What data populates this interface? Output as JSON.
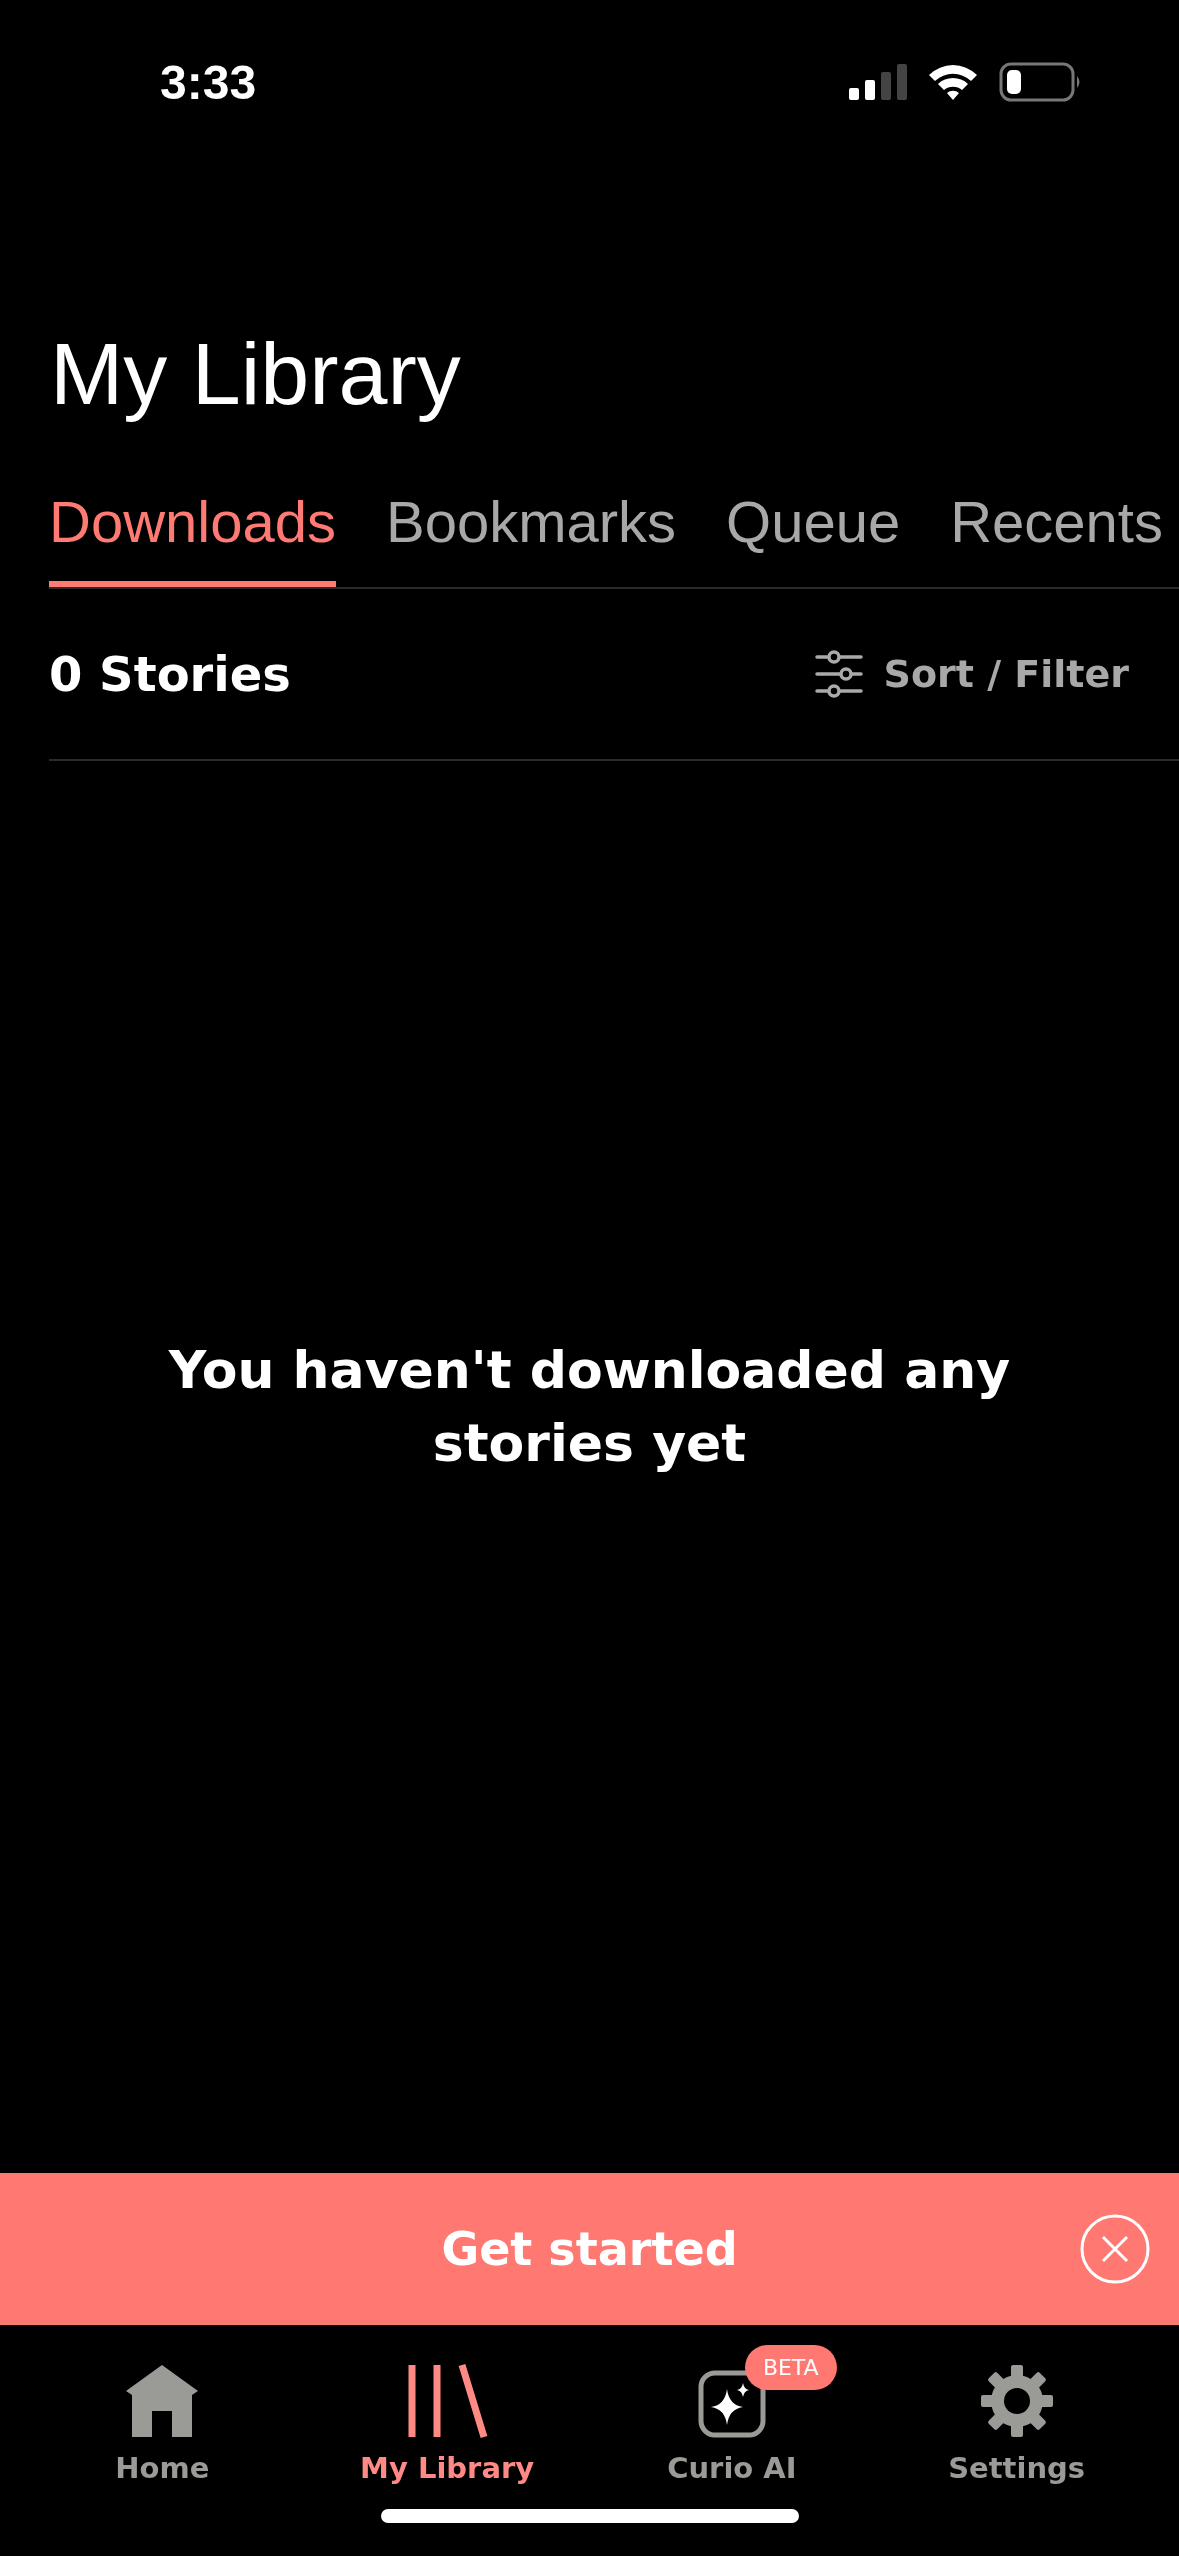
{
  "status_bar": {
    "time": "3:33"
  },
  "title": "My Library",
  "tabs": [
    {
      "label": "Downloads",
      "selected": true
    },
    {
      "label": "Bookmarks",
      "selected": false
    },
    {
      "label": "Queue",
      "selected": false
    },
    {
      "label": "Recents",
      "selected": false
    }
  ],
  "list_header": {
    "count": "0 Stories",
    "sort_filter": "Sort / Filter"
  },
  "empty_message": "You haven't downloaded any stories yet",
  "banner": {
    "label": "Get started"
  },
  "tab_bar": [
    {
      "kind": "home",
      "label": "Home",
      "selected": false
    },
    {
      "kind": "library",
      "label": "My Library",
      "selected": true
    },
    {
      "kind": "ai",
      "label": "Curio AI",
      "selected": false,
      "badge": "BETA"
    },
    {
      "kind": "settings",
      "label": "Settings",
      "selected": false
    }
  ]
}
